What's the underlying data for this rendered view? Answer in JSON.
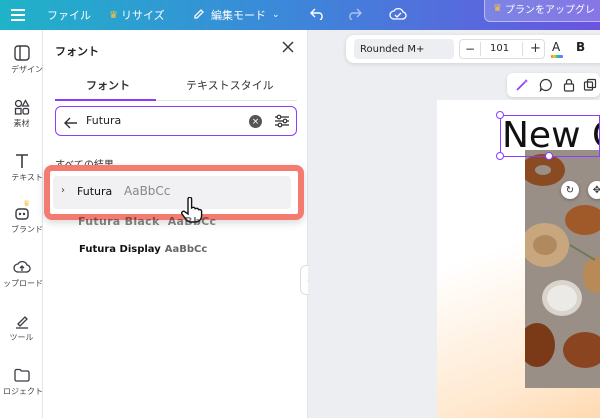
{
  "topbar": {
    "file_label": "ファイル",
    "resize_label": "リサイズ",
    "edit_mode_label": "編集モード",
    "upgrade_label": "プランをアップグレ"
  },
  "rail": {
    "items": [
      {
        "label": "デザイン",
        "icon": "layout-icon"
      },
      {
        "label": "素材",
        "icon": "elements-icon"
      },
      {
        "label": "テキスト",
        "icon": "text-icon"
      },
      {
        "label": "ブランド",
        "icon": "brand-icon"
      },
      {
        "label": "ップロード",
        "icon": "upload-icon"
      },
      {
        "label": "ツール",
        "icon": "draw-icon"
      },
      {
        "label": "ロジェクト",
        "icon": "folder-icon"
      }
    ]
  },
  "panel": {
    "title": "フォント",
    "tabs": [
      {
        "label": "フォント",
        "active": true
      },
      {
        "label": "テキストスタイル",
        "active": false
      }
    ],
    "search": {
      "value": "Futura"
    },
    "section_label": "すべての結果",
    "results": [
      {
        "name": "Futura",
        "sample": "AaBbCc"
      },
      {
        "name": "Futura Black",
        "sample": "AaBbCc"
      },
      {
        "name": "Futura Display",
        "sample": "AaBbCc"
      }
    ]
  },
  "toolbar": {
    "font_name": "Rounded M+",
    "minus": "−",
    "font_size": "101",
    "plus": "+",
    "text_color_label": "A",
    "bold_label": "B"
  },
  "canvas": {
    "headline": "New C"
  },
  "colors": {
    "accent": "#8b3dff",
    "highlight": "#f47b6f"
  }
}
